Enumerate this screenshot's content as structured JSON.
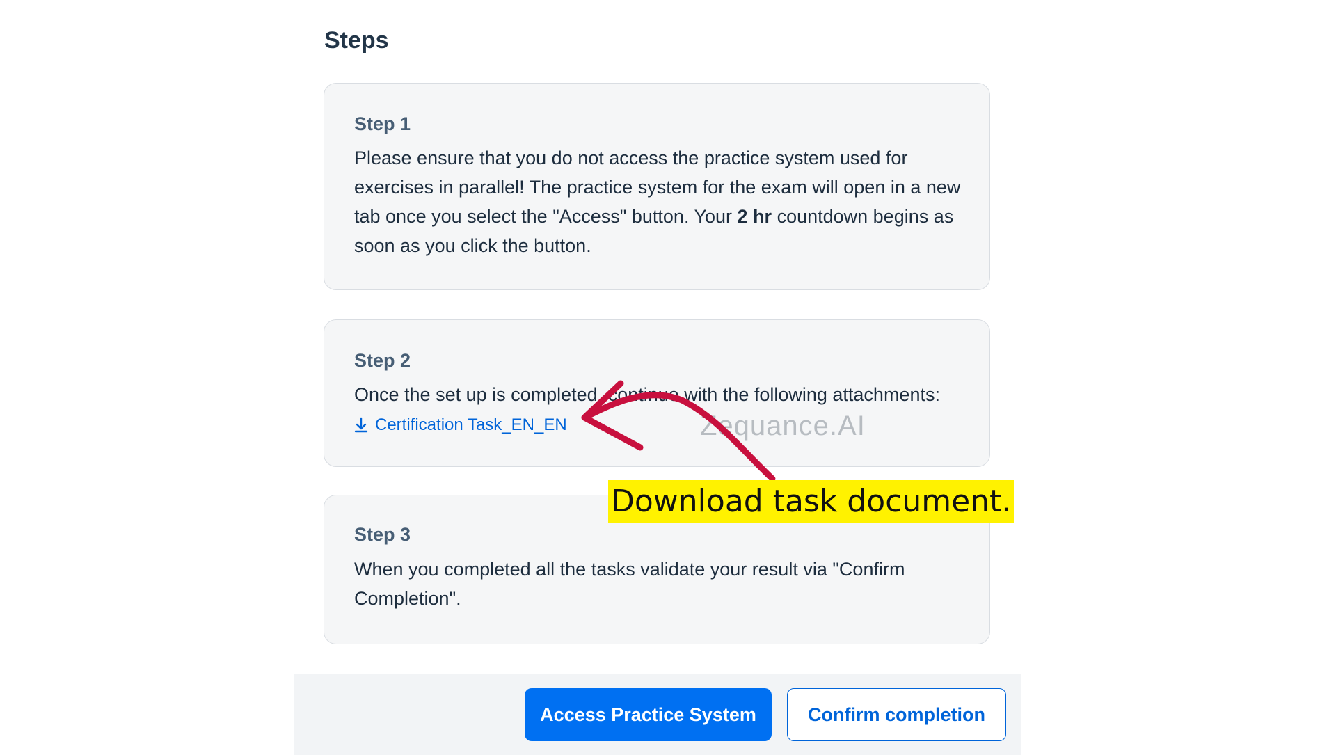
{
  "heading": "Steps",
  "steps": [
    {
      "title": "Step 1",
      "text_before": "Please ensure that you do not access the practice system used for exercises in parallel! The practice system for the exam will open in a new tab once you select the \"Access\" button. Your ",
      "text_bold": "2 hr",
      "text_after": " countdown begins as soon as you click the button."
    },
    {
      "title": "Step 2",
      "text": "Once the set up is completed, continue with the following attachments:",
      "attachment_label": "Certification Task_EN_EN",
      "attachment_icon": "download-icon"
    },
    {
      "title": "Step 3",
      "text": "When you completed all the tasks validate your result via \"Confirm Completion\"."
    }
  ],
  "buttons": {
    "access": "Access Practice System",
    "confirm": "Confirm completion"
  },
  "annotation": {
    "callout": "Download task document.",
    "watermark": "Zequance.AI",
    "arrow_color": "#c8103e",
    "highlight_color": "#fff200"
  }
}
